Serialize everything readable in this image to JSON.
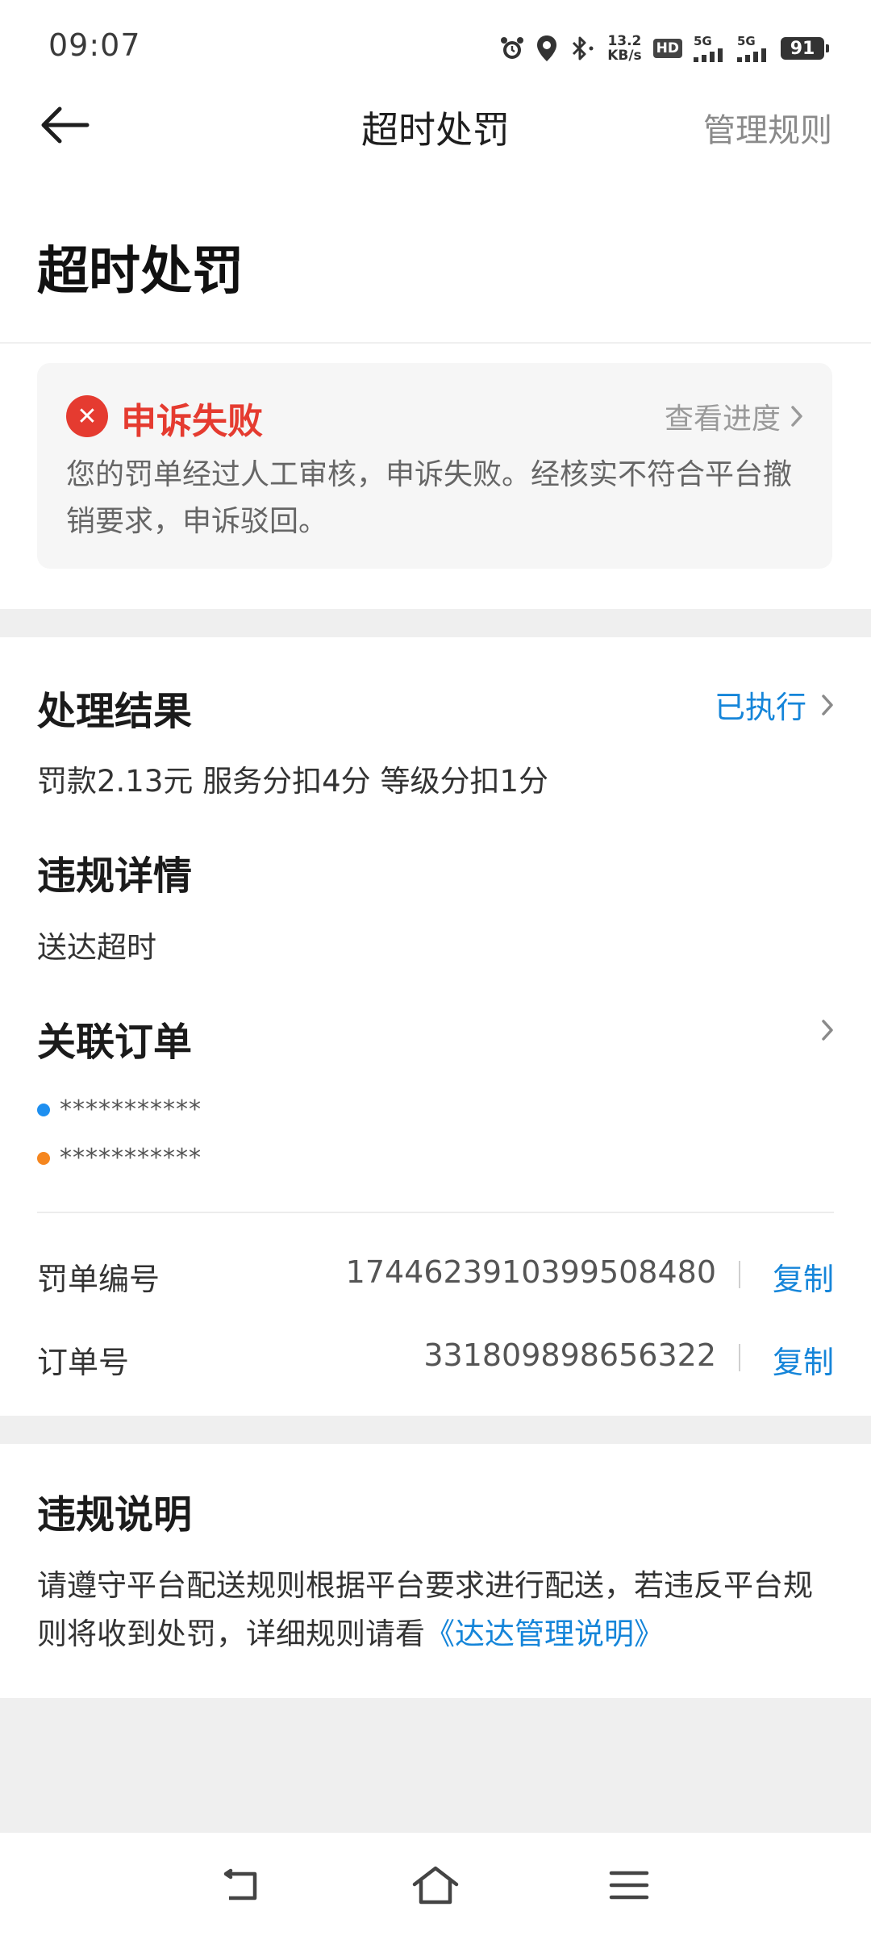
{
  "status_bar": {
    "time": "09:07",
    "net_speed_value": "13.2",
    "net_speed_unit": "KB/s",
    "hd_label": "HD",
    "signal1_label": "5G",
    "signal2_label": "5G",
    "battery_level": "91",
    "icons": [
      "alarm-icon",
      "location-icon",
      "bluetooth-icon",
      "signal-icon",
      "battery-icon"
    ]
  },
  "header": {
    "title": "超时处罚",
    "action": "管理规则"
  },
  "page_title": "超时处罚",
  "appeal": {
    "status": "申诉失败",
    "progress_link": "查看进度",
    "description": "您的罚单经过人工审核，申诉失败。经核实不符合平台撤销要求，申诉驳回。",
    "status_color": "#e53b30"
  },
  "result": {
    "heading": "处理结果",
    "executed_label": "已执行",
    "penalty_text": "罚款2.13元 服务分扣4分 等级分扣1分"
  },
  "violation": {
    "heading": "违规详情",
    "detail": "送达超时"
  },
  "related_orders": {
    "heading": "关联订单",
    "items": [
      {
        "text": "***********",
        "dot_color": "#1e8ff0"
      },
      {
        "text": "***********",
        "dot_color": "#f5861f"
      }
    ]
  },
  "ticket": {
    "label": "罚单编号",
    "value": "1744623910399508480",
    "copy_label": "复制"
  },
  "order": {
    "label": "订单号",
    "value": "331809898656322",
    "copy_label": "复制"
  },
  "rules": {
    "heading": "违规说明",
    "text_before": "请遵守平台配送规则根据平台要求进行配送，若违反平台规则将收到处罚，详细规则请看",
    "link_text": "《达达管理说明》"
  },
  "accent_color": "#1585d9"
}
